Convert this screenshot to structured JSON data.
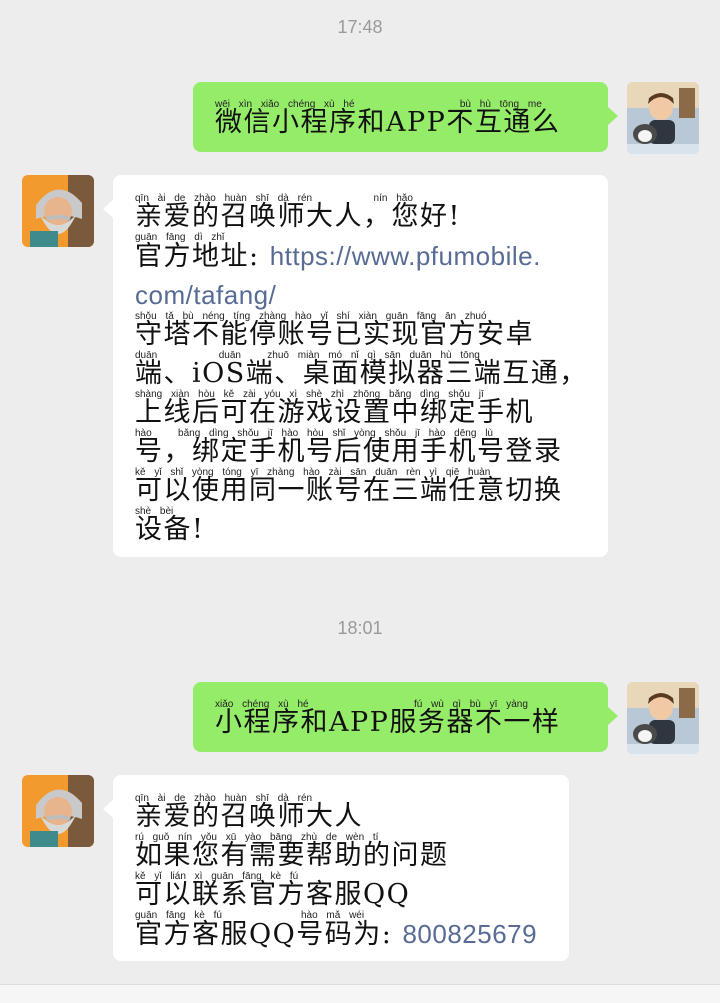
{
  "timestamps": [
    "17:48",
    "18:01"
  ],
  "messages": [
    {
      "sender": "me",
      "pinyin": [
        "wēi xìn xiǎo chéng xù hé            bù hù tōng me"
      ],
      "lines": [
        "微信小程序和APP不互通么"
      ]
    },
    {
      "sender": "other",
      "pinyin": [
        "qīn ài de zhào huàn shī dà rén       nín hǎo",
        "guān fāng dì zhǐ",
        "",
        "shǒu tǎ bù néng tíng zhàng hào yǐ shí xiàn guān fāng ān zhuó",
        "duān       duān   zhuō miàn mó nǐ qì sān duān hù tōng",
        "shàng xiàn hòu kě zài yóu xì shè zhì zhōng bǎng dìng shǒu jī",
        "hào   bǎng dìng shǒu jī hào hòu shǐ yòng shǒu jī hào dēng lù",
        "kě yǐ shǐ yòng tóng yī zhàng hào zài sān duān rèn yì qiē huàn",
        "shè bèi"
      ],
      "lines": [
        "亲爱的召唤师大人，您好!",
        "官方地址: ",
        "com/tafang/",
        "守塔不能停账号已实现官方安卓",
        "端、iOS端、桌面模拟器三端互通，",
        "上线后可在游戏设置中绑定手机",
        "号，绑定手机号后使用手机号登录",
        "可以使用同一账号在三端任意切换",
        "设备!"
      ],
      "link_part": "https://www.pfumobile."
    },
    {
      "sender": "me",
      "pinyin": [
        "xiǎo chéng xù hé            fú wù qì bù yī yàng"
      ],
      "lines": [
        "小程序和APP服务器不一样"
      ]
    },
    {
      "sender": "other",
      "pinyin": [
        "qīn ài de zhào huàn shī dà rén",
        "rú guǒ nín yǒu xū yào bāng zhù de wèn tí",
        "kě yǐ lián xì guān fāng kè fú",
        "guān fāng kè fú         hào mǎ wéi"
      ],
      "lines": [
        "亲爱的召唤师大人",
        "如果您有需要帮助的问题",
        "可以联系官方客服QQ",
        "官方客服QQ号码为: "
      ],
      "qq_number": "800825679"
    }
  ],
  "avatars": {
    "me": "user-avatar",
    "other": "wizard-avatar"
  }
}
